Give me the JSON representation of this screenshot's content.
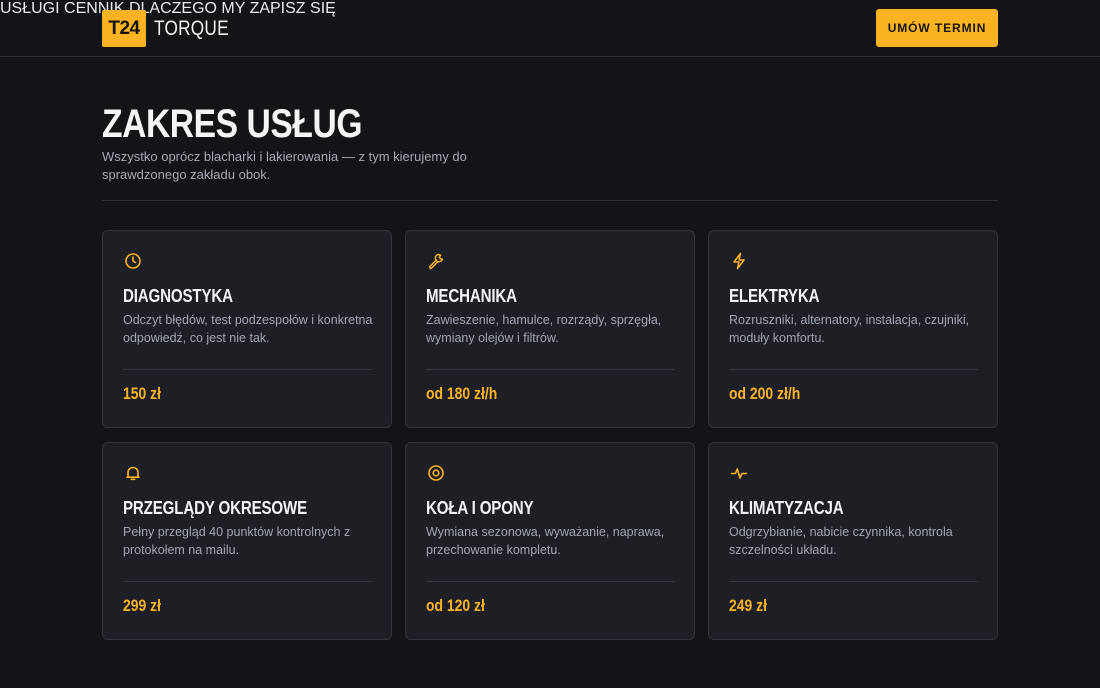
{
  "brand": {
    "badge": "T24",
    "name": "TORQUE"
  },
  "nav": {
    "items": [
      "USŁUGI",
      "CENNIK",
      "DLACZEGO MY",
      "ZAPISZ SIĘ"
    ],
    "cta": "UMÓW TERMIN"
  },
  "hero": {
    "title": "ZAKRES USŁUG",
    "subtitle": "Wszystko oprócz blacharki i lakierowania — z tym kierujemy do sprawdzonego zakładu obok."
  },
  "colors": {
    "accent": "#fbb321",
    "background": "#131418",
    "card": "#1d1f25"
  },
  "services": [
    {
      "icon": "clock-icon",
      "title": "DIAGNOSTYKA",
      "description": "Odczyt błędów, test podzespołów i konkretna odpowiedź, co jest nie tak.",
      "price": "150 zł"
    },
    {
      "icon": "wrench-icon",
      "title": "MECHANIKA",
      "description": "Zawieszenie, hamulce, rozrządy, sprzęgła, wymiany olejów i filtrów.",
      "price": "od 180 zł/h"
    },
    {
      "icon": "lightning-icon",
      "title": "ELEKTRYKA",
      "description": "Rozruszniki, alternatory, instalacja, czujniki, moduły komfortu.",
      "price": "od 200 zł/h"
    },
    {
      "icon": "bell-icon",
      "title": "PRZEGLĄDY OKRESOWE",
      "description": "Pełny przegląd 40 punktów kontrolnych z protokołem na mailu.",
      "price": "299 zł"
    },
    {
      "icon": "wheel-icon",
      "title": "KOŁA I OPONY",
      "description": "Wymiana sezonowa, wyważanie, naprawa, przechowanie kompletu.",
      "price": "od 120 zł"
    },
    {
      "icon": "pulse-icon",
      "title": "KLIMATYZACJA",
      "description": "Odgrzybianie, nabicie czynnika, kontrola szczelności układu.",
      "price": "249 zł"
    }
  ]
}
